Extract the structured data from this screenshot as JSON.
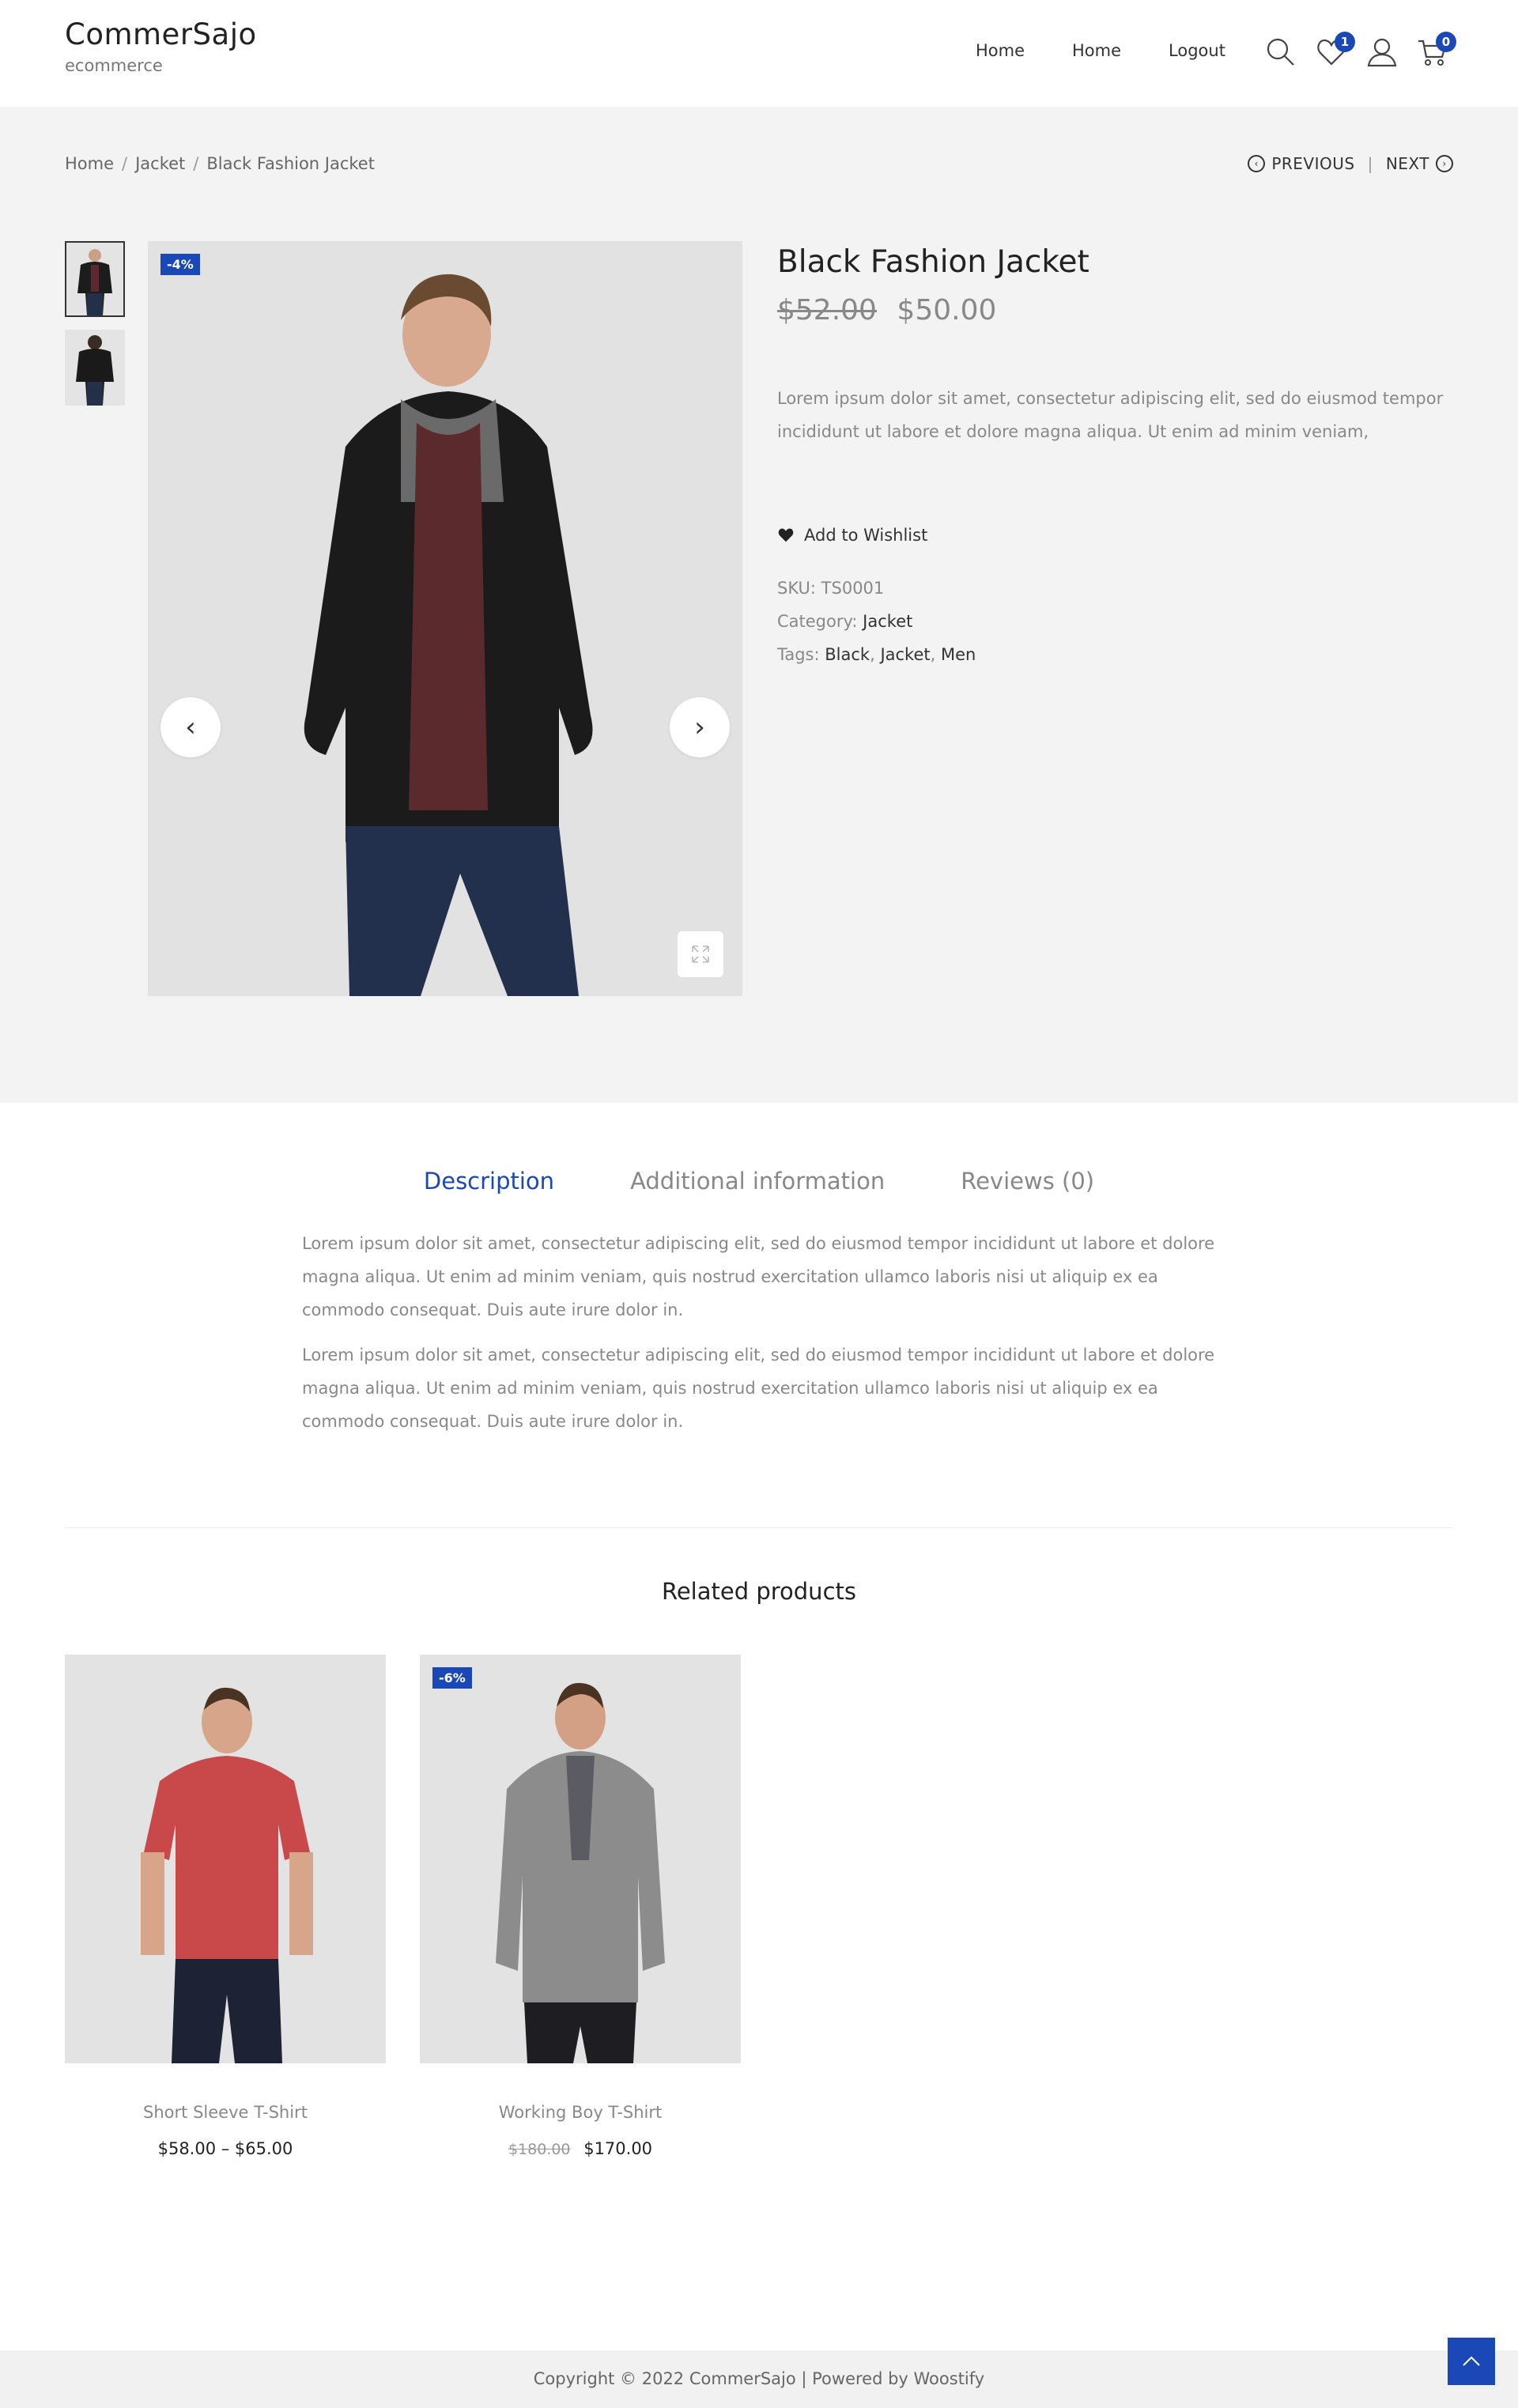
{
  "header": {
    "site_title": "CommerSajo",
    "site_tagline": "ecommerce",
    "nav": [
      "Home",
      "Home",
      "Logout"
    ],
    "wishlist_count": "1",
    "cart_count": "0"
  },
  "breadcrumb": [
    "Home",
    "Jacket",
    "Black Fashion Jacket"
  ],
  "pagination": {
    "previous": "PREVIOUS",
    "next": "NEXT"
  },
  "product": {
    "sale_badge": "-4%",
    "title": "Black Fashion Jacket",
    "old_price": "$52.00",
    "price": "$50.00",
    "short_description": "Lorem ipsum dolor sit amet, consectetur adipiscing elit, sed do eiusmod tempor incididunt ut labore et dolore magna aliqua. Ut enim ad minim veniam,",
    "wishlist_label": "Add to Wishlist",
    "sku_label": "SKU:",
    "sku": "TS0001",
    "category_label": "Category:",
    "category": "Jacket",
    "tags_label": "Tags:",
    "tags": [
      "Black",
      "Jacket",
      "Men"
    ]
  },
  "tabs": [
    "Description",
    "Additional information",
    "Reviews (0)"
  ],
  "description": [
    "Lorem ipsum dolor sit amet, consectetur adipiscing elit, sed do eiusmod tempor incididunt ut labore et dolore magna aliqua. Ut enim ad minim veniam, quis nostrud exercitation ullamco laboris nisi ut aliquip ex ea commodo consequat. Duis aute irure dolor in.",
    "Lorem ipsum dolor sit amet, consectetur adipiscing elit, sed do eiusmod tempor incididunt ut labore et dolore magna aliqua. Ut enim ad minim veniam, quis nostrud exercitation ullamco laboris nisi ut aliquip ex ea commodo consequat. Duis aute irure dolor in."
  ],
  "related": {
    "title": "Related products",
    "items": [
      {
        "name": "Short Sleeve T-Shirt",
        "price_range": "$58.00 – $65.00"
      },
      {
        "name": "Working Boy T-Shirt",
        "badge": "-6%",
        "old_price": "$180.00",
        "price": "$170.00"
      }
    ]
  },
  "footer": {
    "copyright": "Copyright © 2022 CommerSajo | Powered by Woostify"
  },
  "colors": {
    "accent": "#1b48b7",
    "product_bg": "#f3f3f3",
    "footer_bg": "#f1f1f1"
  }
}
